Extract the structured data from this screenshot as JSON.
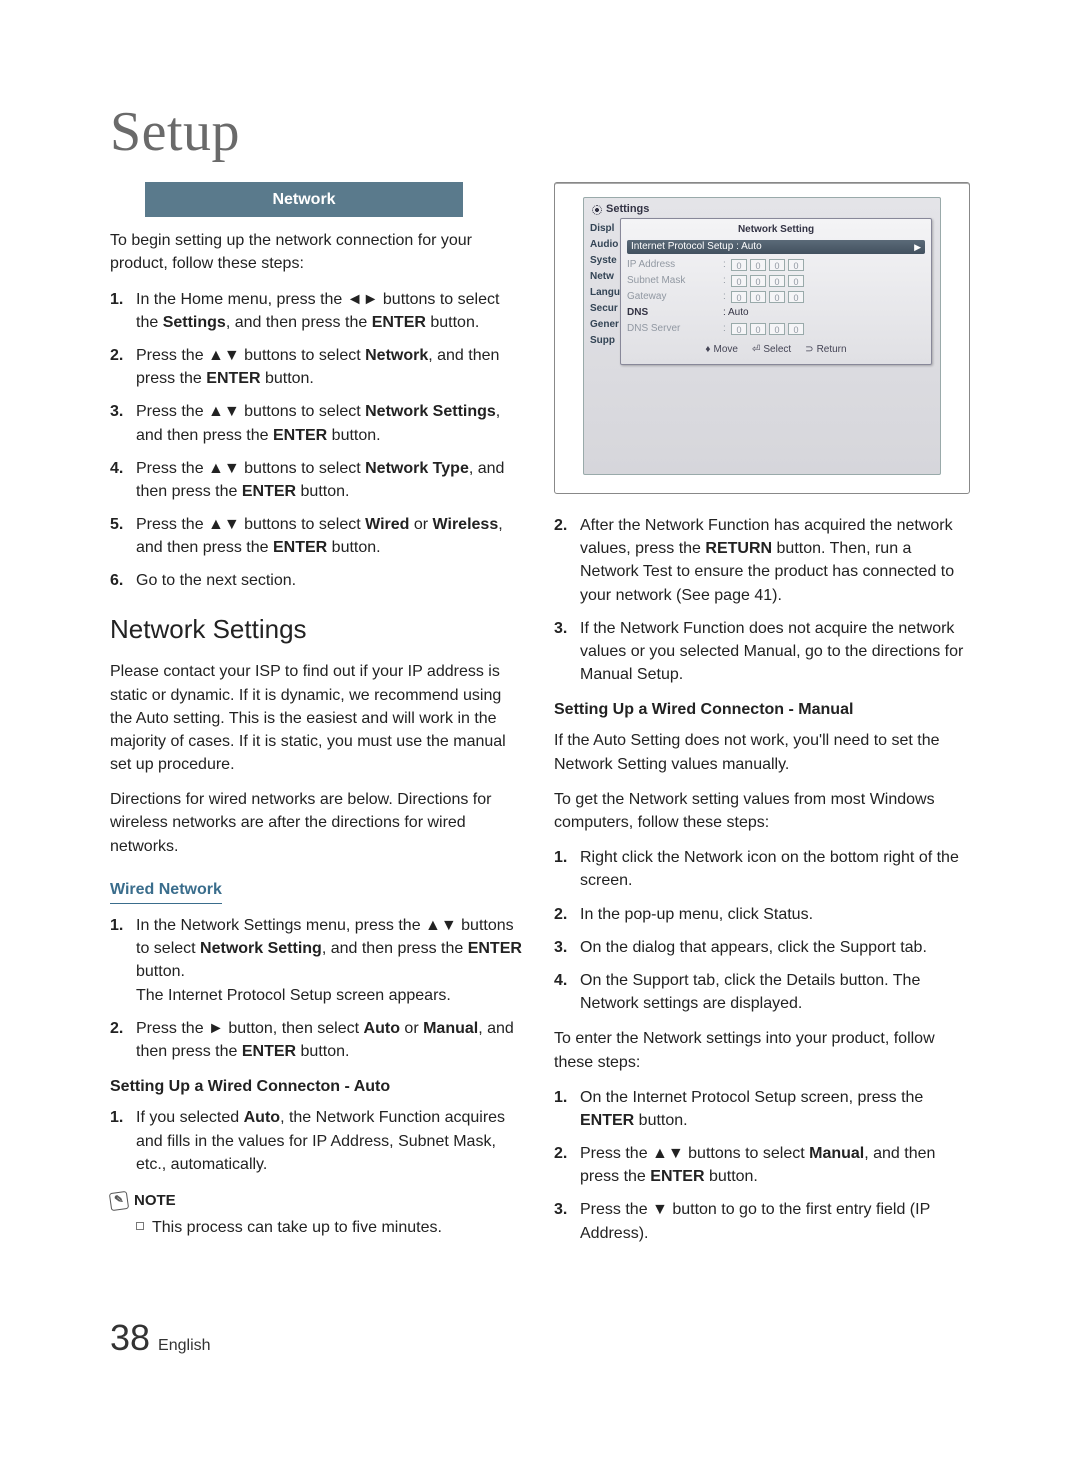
{
  "chapter": "Setup",
  "networkBar": "Network",
  "intro": "To begin setting up the network connection for your product, follow these steps:",
  "steps1": [
    {
      "n": "1.",
      "pre": "In the Home menu, press the ",
      "sym": "◄►",
      "mid": " buttons to select the ",
      "b1": "Settings",
      "mid2": ", and then press the ",
      "b2": "ENTER",
      "post": " button."
    },
    {
      "n": "2.",
      "pre": "Press the ",
      "sym": "▲▼",
      "mid": " buttons to select ",
      "b1": "Network",
      "mid2": ", and then press the ",
      "b2": "ENTER",
      "post": " button."
    },
    {
      "n": "3.",
      "pre": "Press the ",
      "sym": "▲▼",
      "mid": " buttons to select ",
      "b1": "Network Settings",
      "mid2": ", and then press the ",
      "b2": "ENTER",
      "post": " button."
    },
    {
      "n": "4.",
      "pre": "Press the ",
      "sym": "▲▼",
      "mid": " buttons to select ",
      "b1": "Network Type",
      "mid2": ", and then press the ",
      "b2": "ENTER",
      "post": " button."
    },
    {
      "n": "5.",
      "pre": "Press the ",
      "sym": "▲▼",
      "mid": " buttons to select ",
      "b1": "Wired",
      "mid1b": " or ",
      "b1b": "Wireless",
      "mid2": ", and then press the ",
      "b2": "ENTER",
      "post": " button."
    },
    {
      "n": "6.",
      "pre": "Go to the next section.",
      "sym": "",
      "mid": "",
      "b1": "",
      "mid2": "",
      "b2": "",
      "post": ""
    }
  ],
  "h2": "Network Settings",
  "nsIntro1": "Please contact your ISP to find out if your IP address is static or dynamic. If it is dynamic, we recommend using the Auto setting. This is the easiest and will work in the majority of cases. If it is static, you must use the manual set up procedure.",
  "nsIntro2": "Directions for wired networks are below. Directions for wireless networks are after the directions for wired networks.",
  "wiredHead": "Wired Network",
  "wiredSteps": [
    {
      "n": "1.",
      "t1": "In the Network Settings menu, press the ",
      "sym": "▲▼",
      "t2": " buttons to select ",
      "b": "Network Setting",
      "t3": ", and then press the ",
      "b2": "ENTER",
      "t4": " button.",
      "extra": "The Internet Protocol Setup screen appears."
    },
    {
      "n": "2.",
      "t1": "Press the ",
      "sym": "►",
      "t2": " button, then select ",
      "b": "Auto",
      "t2b": " or ",
      "bB": "Manual",
      "t3": ", and then press the ",
      "b2": "ENTER",
      "t4": " button."
    }
  ],
  "autoHead": "Setting Up a Wired Connecton - Auto",
  "autoSteps": [
    {
      "n": "1.",
      "t1": "If you selected ",
      "b": "Auto",
      "t2": ", the Network Function acquires and fills in the values for IP Address, Subnet Mask, etc., automatically."
    }
  ],
  "noteLabel": "NOTE",
  "noteItem": "This process can take up to five minutes.",
  "rightSteps1": [
    {
      "n": "2.",
      "t1": "After the Network Function has acquired the network values, press the ",
      "b": "RETURN",
      "t2": " button. Then, run a Network Test to ensure the product has connected to your network (See page 41)."
    },
    {
      "n": "3.",
      "t1": "If the Network Function does not acquire the network values or you selected Manual, go to the directions for Manual Setup."
    }
  ],
  "manualHead": "Setting Up a Wired Connecton - Manual",
  "manualIntro1": "If the Auto Setting does not work, you'll need to set the Network Setting values manually.",
  "manualIntro2": "To get the Network setting values from most Windows computers, follow these steps:",
  "manualStepsA": [
    {
      "n": "1.",
      "t": "Right click the Network icon on the bottom right of the screen."
    },
    {
      "n": "2.",
      "t": "In the pop-up menu, click Status."
    },
    {
      "n": "3.",
      "t": "On the dialog that appears, click the Support tab."
    },
    {
      "n": "4.",
      "t": "On the Support tab, click the Details button. The Network settings are displayed."
    }
  ],
  "manualIntro3": "To enter the Network settings into your product, follow these steps:",
  "manualStepsB": [
    {
      "n": "1.",
      "t1": "On the Internet Protocol Setup screen, press the ",
      "b": "ENTER",
      "t2": " button."
    },
    {
      "n": "2.",
      "t1": "Press the ",
      "sym": "▲▼",
      "t2": " buttons to select ",
      "b": "Manual",
      "t3": ", and then press the ",
      "b2": "ENTER",
      "t4": " button."
    },
    {
      "n": "3.",
      "t1": "Press the ",
      "sym": "▼",
      "t2": " button to go to the first entry field (IP Address)."
    }
  ],
  "tv": {
    "settings": "Settings",
    "side": [
      "Displ",
      "Audio",
      "Syste",
      "Netw",
      "Langu",
      "Secur",
      "Gener",
      "Supp"
    ],
    "panelTitle": "Network Setting",
    "dropdown": "Internet Protocol Setup  : Auto",
    "rows": [
      {
        "label": "IP Address",
        "oct": [
          "0",
          "0",
          "0",
          "0"
        ]
      },
      {
        "label": "Subnet Mask",
        "oct": [
          "0",
          "0",
          "0",
          "0"
        ]
      },
      {
        "label": "Gateway",
        "oct": [
          "0",
          "0",
          "0",
          "0"
        ]
      }
    ],
    "dnsLabel": "DNS",
    "dnsVal": ": Auto",
    "dnsServer": {
      "label": "DNS Server",
      "oct": [
        "0",
        "0",
        "0",
        "0"
      ]
    },
    "foot": {
      "move": "Move",
      "select": "Select",
      "return": "Return"
    }
  },
  "page": {
    "num": "38",
    "lang": "English"
  }
}
